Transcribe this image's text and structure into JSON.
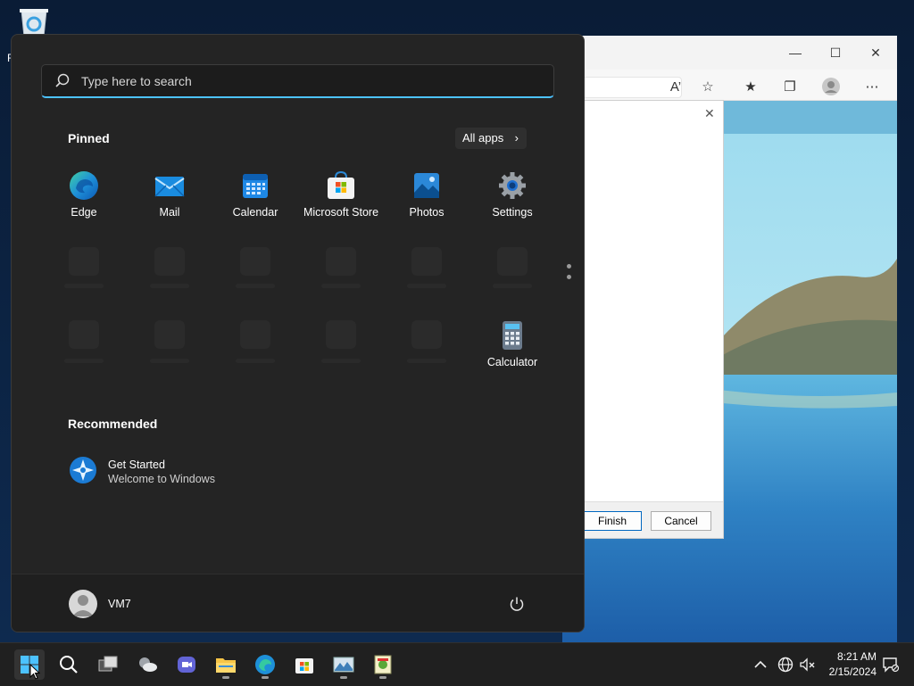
{
  "desktop": {
    "recycle_label": "R"
  },
  "start_menu": {
    "search_placeholder": "Type here to search",
    "pinned_title": "Pinned",
    "all_apps_label": "All apps",
    "pinned": [
      {
        "label": "Edge",
        "icon": "edge-icon"
      },
      {
        "label": "Mail",
        "icon": "mail-icon"
      },
      {
        "label": "Calendar",
        "icon": "calendar-icon"
      },
      {
        "label": "Microsoft Store",
        "icon": "store-icon"
      },
      {
        "label": "Photos",
        "icon": "photos-icon"
      },
      {
        "label": "Settings",
        "icon": "settings-icon"
      },
      {
        "label": "Calculator",
        "icon": "calculator-icon"
      }
    ],
    "recommended_title": "Recommended",
    "recommended": [
      {
        "title": "Get Started",
        "subtitle": "Welcome to Windows",
        "icon": "get-started-icon"
      }
    ],
    "user_name": "VM7"
  },
  "browser": {
    "dialog": {
      "finish_label": "Finish",
      "cancel_label": "Cancel"
    }
  },
  "taskbar": {
    "time": "8:21 AM",
    "date": "2/15/2024"
  }
}
